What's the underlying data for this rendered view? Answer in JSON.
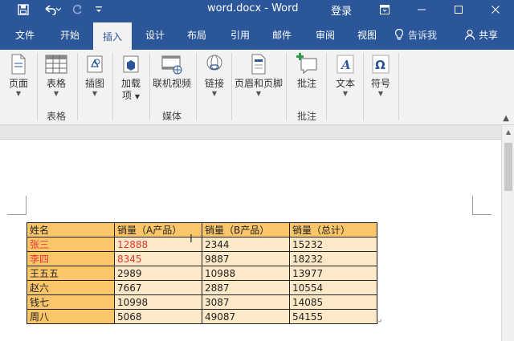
{
  "titlebar": {
    "title": "word.docx  -  Word",
    "login": "登录",
    "icons": [
      "save-icon",
      "undo-icon",
      "redo-icon",
      "customize-icon",
      "ribbon-display-icon",
      "minimize-icon",
      "maximize-icon",
      "close-icon"
    ]
  },
  "tabs": [
    {
      "label": "文件"
    },
    {
      "label": "开始"
    },
    {
      "label": "插入",
      "active": true
    },
    {
      "label": "设计"
    },
    {
      "label": "布局"
    },
    {
      "label": "引用"
    },
    {
      "label": "邮件"
    },
    {
      "label": "审阅"
    },
    {
      "label": "视图"
    },
    {
      "label": "告诉我"
    },
    {
      "label": "共享"
    }
  ],
  "ribbon": {
    "buttons": {
      "page": "页面",
      "table": "表格",
      "illustration": "插图",
      "addins_1": "加载",
      "addins_2": "项",
      "online_video": "联机视频",
      "link": "链接",
      "header_footer": "页眉和页脚",
      "comment": "批注",
      "text": "文本",
      "symbol": "符号"
    },
    "groups": {
      "table": "表格",
      "media": "媒体",
      "comment": "批注"
    }
  },
  "table": {
    "headers": [
      "姓名",
      "销量（A产品）",
      "销量（B产品）",
      "销量（总计）"
    ],
    "rows": [
      [
        "张三",
        "12888",
        "2344",
        "15232"
      ],
      [
        "李四",
        "8345",
        "9887",
        "18232"
      ],
      [
        "王五五",
        "2989",
        "10988",
        "13977"
      ],
      [
        "赵六",
        "7667",
        "2887",
        "10554"
      ],
      [
        "钱七",
        "10998",
        "3087",
        "14085"
      ],
      [
        "周八",
        "5068",
        "49087",
        "54155"
      ]
    ],
    "highlight_color": "#e53935"
  },
  "colors": {
    "accent": "#2b579a",
    "header_fill": "#fbc569",
    "body_fill": "#fde9c8"
  }
}
